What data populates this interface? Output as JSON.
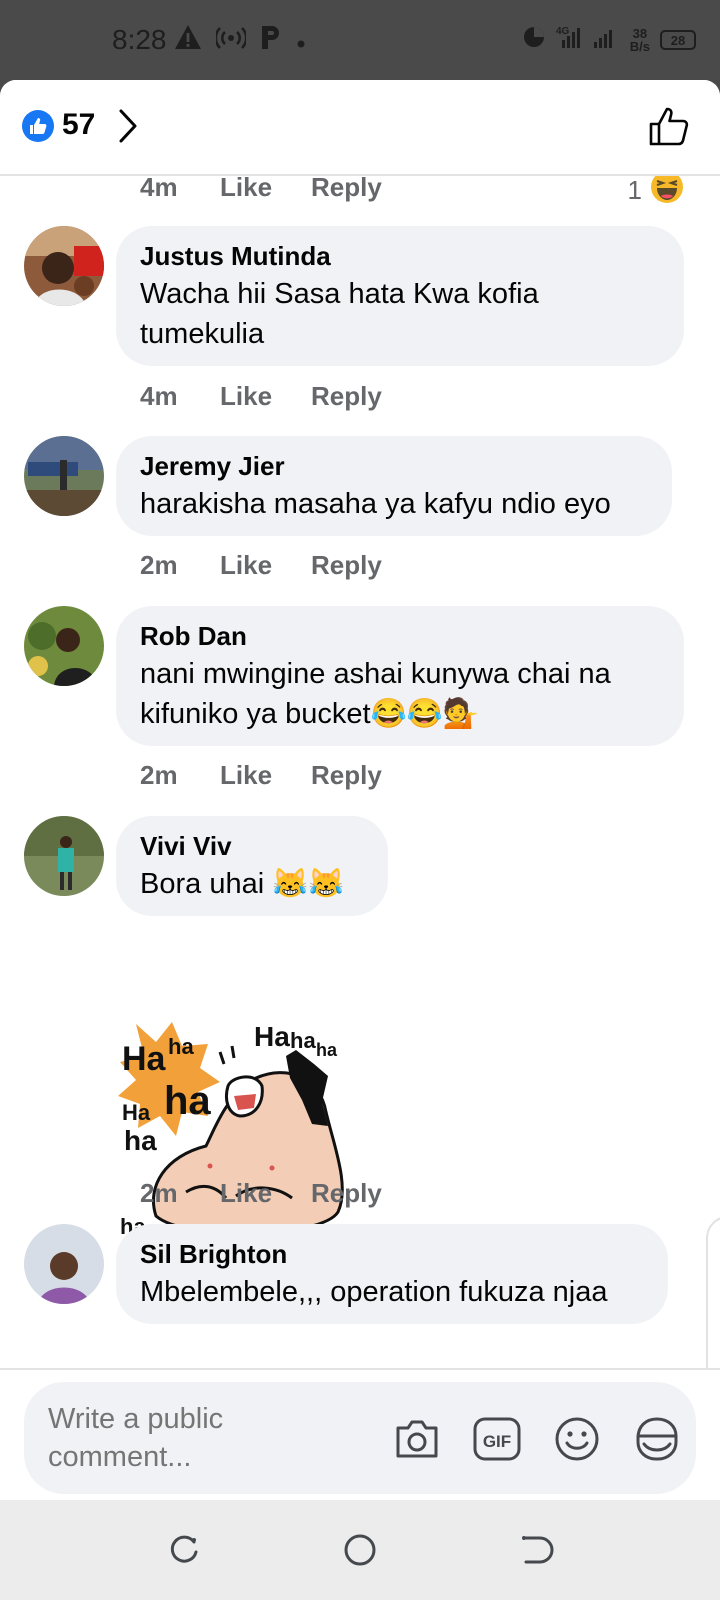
{
  "status_bar": {
    "time": "8:28",
    "network_type": "4G",
    "net_speed_value": "38",
    "net_speed_unit": "B/s",
    "battery": "28",
    "icons": [
      "warning-icon",
      "hotspot-icon",
      "parking-app-icon",
      "dot-icon",
      "data-saver-icon",
      "signal-icon",
      "battery-icon"
    ]
  },
  "header": {
    "like_count": "57",
    "icons": [
      "like-badge-icon",
      "chevron-right-icon",
      "thumbs-up-outline-icon"
    ]
  },
  "top_partial": {
    "time": "4m",
    "like": "Like",
    "reply": "Reply",
    "reaction_count": "1",
    "reaction_icon": "haha-emoji-icon"
  },
  "comments": [
    {
      "author": "Justus Mutinda",
      "text_lines": [
        "Wacha hii  Sasa hata Kwa kofia",
        "tumekulia"
      ],
      "time": "4m",
      "like": "Like",
      "reply": "Reply"
    },
    {
      "author": "Jeremy Jier",
      "text_lines": [
        "harakisha masaha ya kafyu ndio eyo"
      ],
      "time": "2m",
      "like": "Like",
      "reply": "Reply"
    },
    {
      "author": "Rob Dan",
      "text_lines": [
        "nani mwingine ashai kunywa chai na",
        "kifuniko ya bucket😂😂💁"
      ],
      "time": "2m",
      "like": "Like",
      "reply": "Reply"
    },
    {
      "author": "Vivi Viv",
      "text_lines": [
        "Bora uhai 😹😹"
      ],
      "time": "2m",
      "like": "Like",
      "reply": "Reply"
    },
    {
      "author": "Sil Brighton",
      "text_lines": [
        "Mbelembele,,, operation fukuza njaa"
      ]
    }
  ],
  "sticker": {
    "words": [
      "Ha",
      "ha",
      "ha",
      "Ha",
      "ha",
      "ha",
      "Ha",
      "ha",
      "ha"
    ]
  },
  "composer": {
    "placeholder": "Write a public comment...",
    "gif_label": "GIF",
    "icons": [
      "camera-icon",
      "gif-icon",
      "emoji-icon",
      "sticker-icon"
    ]
  },
  "colors": {
    "facebook_blue": "#1877f2",
    "bubble_bg": "#f0f2f5",
    "meta_gray": "#65676b"
  }
}
